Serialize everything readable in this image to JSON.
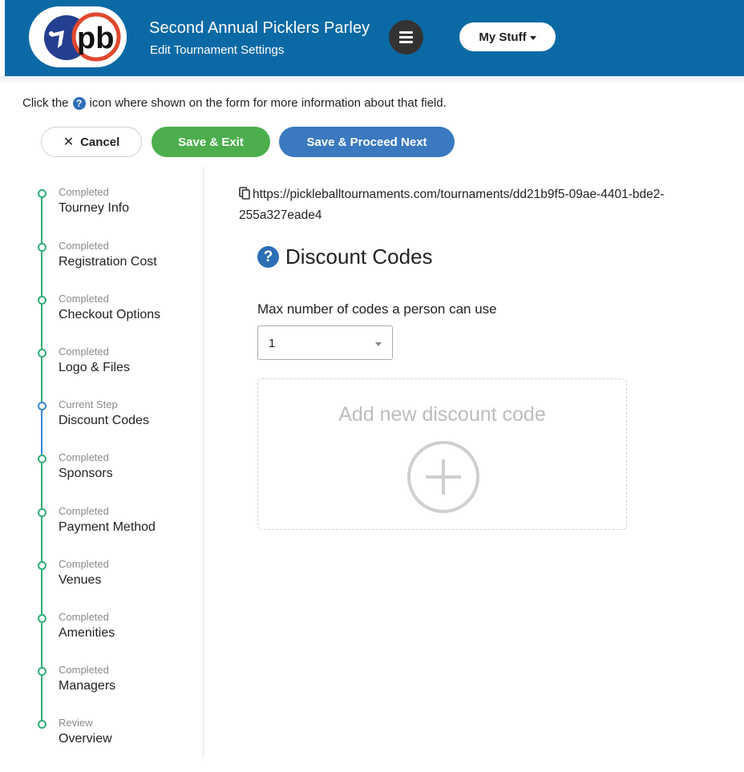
{
  "header": {
    "logo_text": "pb",
    "event_title": "Second Annual Picklers Parley",
    "page_subtitle": "Edit Tournament Settings",
    "menu_icon": "hamburger-icon",
    "my_stuff_label": "My Stuff",
    "brand_color": "#0b6aa5"
  },
  "hint": {
    "before": "Click the",
    "icon": "question-circle-icon",
    "after": "icon where shown on the form for more information about that field."
  },
  "actions": {
    "cancel_label": "Cancel",
    "save_exit_label": "Save & Exit",
    "save_next_label": "Save & Proceed Next",
    "save_exit_color": "#4cae4c",
    "save_next_color": "#3a79bf"
  },
  "steps": [
    {
      "status": "Completed",
      "label": "Tourney Info"
    },
    {
      "status": "Completed",
      "label": "Registration Cost"
    },
    {
      "status": "Completed",
      "label": "Checkout Options"
    },
    {
      "status": "Completed",
      "label": "Logo & Files"
    },
    {
      "status": "Current Step",
      "label": "Discount Codes"
    },
    {
      "status": "Completed",
      "label": "Sponsors"
    },
    {
      "status": "Completed",
      "label": "Payment Method"
    },
    {
      "status": "Completed",
      "label": "Venues"
    },
    {
      "status": "Completed",
      "label": "Amenities"
    },
    {
      "status": "Completed",
      "label": "Managers"
    },
    {
      "status": "Review",
      "label": "Overview"
    }
  ],
  "main": {
    "tournament_url": "https://pickleballtournaments.com/tournaments/dd21b9f5-09ae-4401-bde2-255a327eade4",
    "section_title": "Discount Codes",
    "max_codes_label": "Max number of codes a person can use",
    "max_codes_value": "1",
    "add_code_label": "Add new discount code"
  }
}
